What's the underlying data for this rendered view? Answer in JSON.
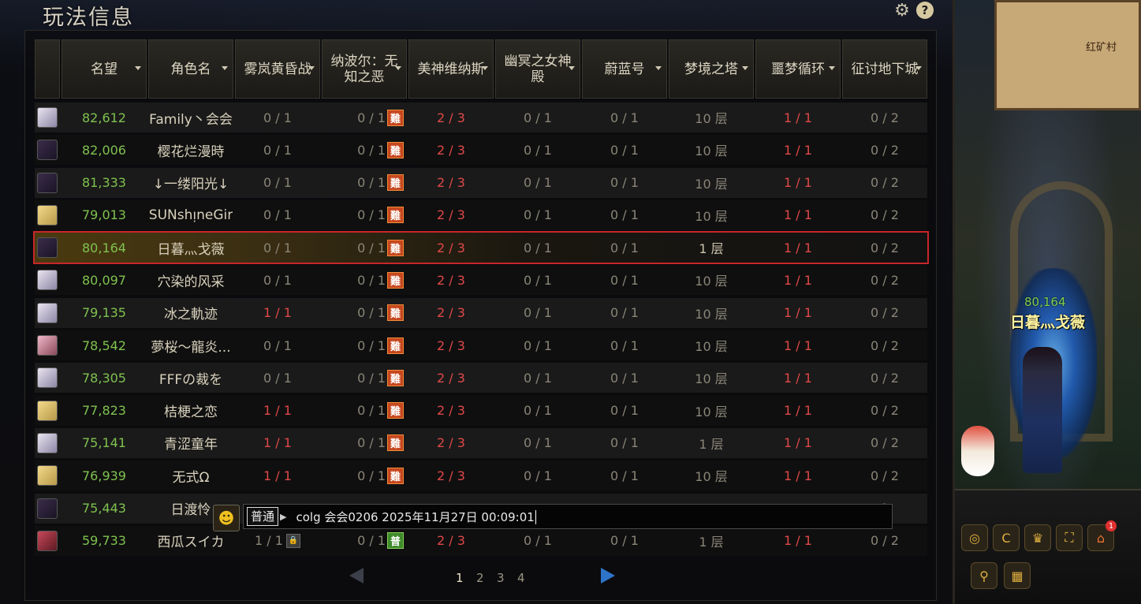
{
  "panel": {
    "title": "玩法信息"
  },
  "columns": [
    {
      "label": "",
      "sortable": false
    },
    {
      "label": "名望",
      "sortable": true
    },
    {
      "label": "角色名",
      "sortable": true
    },
    {
      "label": "雾岚黄昏战",
      "sortable": true
    },
    {
      "label": "纳波尔：无知之恶",
      "sortable": true
    },
    {
      "label": "美神维纳斯",
      "sortable": true
    },
    {
      "label": "幽冥之女神殿",
      "sortable": true
    },
    {
      "label": "蔚蓝号",
      "sortable": true
    },
    {
      "label": "梦境之塔",
      "sortable": true
    },
    {
      "label": "噩梦循环",
      "sortable": true
    },
    {
      "label": "征讨地下城",
      "sortable": true
    }
  ],
  "rows": [
    {
      "avatar": "avatar-silver",
      "fame": "82,612",
      "name": "Family丶会会",
      "c1": "0 / 1",
      "c1_red": false,
      "c2": "0 / 1",
      "c2_badge": "難",
      "c3": "2 / 3",
      "c4": "0 / 1",
      "c5": "0 / 1",
      "c6": "10 层",
      "c7": "1 / 1",
      "c8": "0 / 2",
      "selected": false
    },
    {
      "avatar": "avatar-dark",
      "fame": "82,006",
      "name": "樱花烂漫時",
      "c1": "0 / 1",
      "c1_red": false,
      "c2": "0 / 1",
      "c2_badge": "難",
      "c3": "2 / 3",
      "c4": "0 / 1",
      "c5": "0 / 1",
      "c6": "10 层",
      "c7": "1 / 1",
      "c8": "0 / 2",
      "selected": false
    },
    {
      "avatar": "avatar-dark",
      "fame": "81,333",
      "name": "↓一缕阳光↓",
      "c1": "0 / 1",
      "c1_red": false,
      "c2": "0 / 1",
      "c2_badge": "難",
      "c3": "2 / 3",
      "c4": "0 / 1",
      "c5": "0 / 1",
      "c6": "10 层",
      "c7": "1 / 1",
      "c8": "0 / 2",
      "selected": false
    },
    {
      "avatar": "avatar-blond",
      "fame": "79,013",
      "name": "SUNshᴉneGir",
      "c1": "0 / 1",
      "c1_red": false,
      "c2": "0 / 1",
      "c2_badge": "難",
      "c3": "2 / 3",
      "c4": "0 / 1",
      "c5": "0 / 1",
      "c6": "10 层",
      "c7": "1 / 1",
      "c8": "0 / 2",
      "selected": false
    },
    {
      "avatar": "avatar-dark",
      "fame": "80,164",
      "name": "日暮灬戈薇",
      "c1": "0 / 1",
      "c1_red": false,
      "c2": "0 / 1",
      "c2_badge": "難",
      "c3": "2 / 3",
      "c4": "0 / 1",
      "c5": "0 / 1",
      "c6": "1 层",
      "c7": "1 / 1",
      "c8": "0 / 2",
      "selected": true
    },
    {
      "avatar": "avatar-silver",
      "fame": "80,097",
      "name": "穴染的风采",
      "c1": "0 / 1",
      "c1_red": false,
      "c2": "0 / 1",
      "c2_badge": "難",
      "c3": "2 / 3",
      "c4": "0 / 1",
      "c5": "0 / 1",
      "c6": "10 层",
      "c7": "1 / 1",
      "c8": "0 / 2",
      "selected": false
    },
    {
      "avatar": "avatar-silver",
      "fame": "79,135",
      "name": "冰之軌迹",
      "c1": "1 / 1",
      "c1_red": true,
      "c2": "0 / 1",
      "c2_badge": "難",
      "c3": "2 / 3",
      "c4": "0 / 1",
      "c5": "0 / 1",
      "c6": "10 层",
      "c7": "1 / 1",
      "c8": "0 / 2",
      "selected": false
    },
    {
      "avatar": "avatar-pink",
      "fame": "78,542",
      "name": "夢桜～龍炎...",
      "c1": "0 / 1",
      "c1_red": false,
      "c2": "0 / 1",
      "c2_badge": "難",
      "c3": "2 / 3",
      "c4": "0 / 1",
      "c5": "0 / 1",
      "c6": "10 层",
      "c7": "1 / 1",
      "c8": "0 / 2",
      "selected": false
    },
    {
      "avatar": "avatar-silver",
      "fame": "78,305",
      "name": "FFFの裁を",
      "c1": "0 / 1",
      "c1_red": false,
      "c2": "0 / 1",
      "c2_badge": "難",
      "c3": "2 / 3",
      "c4": "0 / 1",
      "c5": "0 / 1",
      "c6": "10 层",
      "c7": "1 / 1",
      "c8": "0 / 2",
      "selected": false
    },
    {
      "avatar": "avatar-blond",
      "fame": "77,823",
      "name": "桔梗之恋",
      "c1": "1 / 1",
      "c1_red": true,
      "c2": "0 / 1",
      "c2_badge": "難",
      "c3": "2 / 3",
      "c4": "0 / 1",
      "c5": "0 / 1",
      "c6": "10 层",
      "c7": "1 / 1",
      "c8": "0 / 2",
      "selected": false
    },
    {
      "avatar": "avatar-silver",
      "fame": "75,141",
      "name": "青涩童年",
      "c1": "1 / 1",
      "c1_red": true,
      "c2": "0 / 1",
      "c2_badge": "難",
      "c3": "2 / 3",
      "c4": "0 / 1",
      "c5": "0 / 1",
      "c6": "1 层",
      "c7": "1 / 1",
      "c8": "0 / 2",
      "selected": false
    },
    {
      "avatar": "avatar-blond",
      "fame": "76,939",
      "name": "无式Ω",
      "c1": "1 / 1",
      "c1_red": true,
      "c2": "0 / 1",
      "c2_badge": "難",
      "c3": "2 / 3",
      "c4": "0 / 1",
      "c5": "0 / 1",
      "c6": "10 层",
      "c7": "1 / 1",
      "c8": "0 / 2",
      "selected": false
    },
    {
      "avatar": "avatar-dark",
      "fame": "75,443",
      "name": "日渡怜",
      "c1": "",
      "c1_red": false,
      "c2": "",
      "c2_badge": "",
      "c3": "",
      "c4": "",
      "c5": "",
      "c6": "",
      "c7": "",
      "c8": "2",
      "selected": false
    },
    {
      "avatar": "avatar-red",
      "fame": "59,733",
      "name": "西瓜スイカ",
      "c1": "1 / 1",
      "c1_red": false,
      "c1_lock": true,
      "c2": "0 / 1",
      "c2_badge": "普",
      "c3": "2 / 3",
      "c4": "0 / 1",
      "c5": "0 / 1",
      "c6": "1 层",
      "c7": "1 / 1",
      "c8": "0 / 2",
      "selected": false
    }
  ],
  "chat": {
    "channel": "普通",
    "text": "colg 会会0206 2025年11月27日 00:09:01"
  },
  "pagination": {
    "pages": [
      "1",
      "2",
      "3",
      "4"
    ],
    "current": "1"
  },
  "game": {
    "minimap_label": "红矿村",
    "player_fame": "80,164",
    "player_name": "日暮灬戈薇",
    "notification_count": "1"
  },
  "colors": {
    "fame": "#7fc24f",
    "red_value": "#e04848",
    "selected_border": "#c8262a",
    "hard_badge": "#c6471e",
    "normal_badge": "#3f8a2a"
  }
}
